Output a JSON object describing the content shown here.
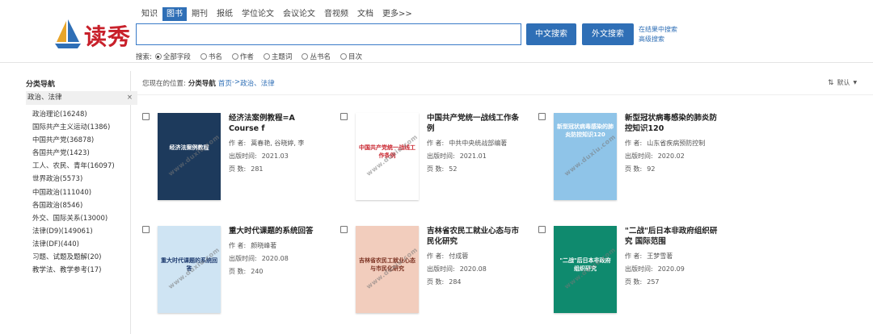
{
  "logo": {
    "text": "读秀"
  },
  "tabs": [
    {
      "label": "知识",
      "active": false
    },
    {
      "label": "图书",
      "active": true
    },
    {
      "label": "期刊",
      "active": false
    },
    {
      "label": "报纸",
      "active": false
    },
    {
      "label": "学位论文",
      "active": false
    },
    {
      "label": "会议论文",
      "active": false
    },
    {
      "label": "音视频",
      "active": false
    },
    {
      "label": "文档",
      "active": false
    },
    {
      "label": "更多>>",
      "active": false
    }
  ],
  "search": {
    "value": "",
    "cn_button": "中文搜索",
    "en_button": "外文搜索"
  },
  "side_links": {
    "in_results": "在结果中搜索",
    "advanced": "高级搜索"
  },
  "scope": {
    "label": "搜索:",
    "options": [
      {
        "label": "全部字段",
        "checked": true
      },
      {
        "label": "书名",
        "checked": false
      },
      {
        "label": "作者",
        "checked": false
      },
      {
        "label": "主题词",
        "checked": false
      },
      {
        "label": "丛书名",
        "checked": false
      },
      {
        "label": "目次",
        "checked": false
      }
    ]
  },
  "sidebar": {
    "title": "分类导航",
    "selected": "政治、法律",
    "close": "×",
    "items": [
      "政治理论(16248)",
      "国际共产主义运动(1386)",
      "中国共产党(36878)",
      "各国共产党(1423)",
      "工人、农民、青年(16097)",
      "世界政治(5573)",
      "中国政治(111040)",
      "各国政治(8546)",
      "外交、国际关系(13000)",
      "法律(D9)(149061)",
      "法律(DF)(440)",
      "习题、试题及题解(20)",
      "教学法、教学参考(17)"
    ]
  },
  "breadcrumb": {
    "prefix": "您现在的位置:",
    "section": "分类导航",
    "home": "首页",
    "sep": "->",
    "current": "政治、法律"
  },
  "sort": {
    "arrow": "⇅",
    "label": "默认",
    "caret": "▼"
  },
  "books": [
    {
      "title": "经济法案例教程=A Course f",
      "author_key": "作 者:",
      "author": "蒿春艳, 谷晓婷, 李",
      "date_key": "出版时间:",
      "date": "2021.03",
      "pages_key": "页 数:",
      "pages": "281",
      "cover_text": "经济法案例教程",
      "cover_bg": "#1d3a5c",
      "cover_fg": "#ffffff"
    },
    {
      "title": "中国共产党统一战线工作条例",
      "author_key": "作 者:",
      "author": "中共中央统战部编著",
      "date_key": "出版时间:",
      "date": "2021.01",
      "pages_key": "页 数:",
      "pages": "52",
      "cover_text": "中国共产党统一战线工作条例",
      "cover_bg": "#ffffff",
      "cover_fg": "#c8202a"
    },
    {
      "title": "新型冠状病毒感染的肺炎防控知识120",
      "author_key": "作 者:",
      "author": "山东省疾病预防控制",
      "date_key": "出版时间:",
      "date": "2020.02",
      "pages_key": "页 数:",
      "pages": "92",
      "cover_text": "新型冠状病毒感染的肺炎防控知识120",
      "cover_bg": "#8fc4e8",
      "cover_fg": "#ffffff"
    },
    {
      "title": "重大时代课题的系统回答",
      "author_key": "作 者:",
      "author": "颜晓峰著",
      "date_key": "出版时间:",
      "date": "2020.08",
      "pages_key": "页 数:",
      "pages": "240",
      "cover_text": "重大时代课题的系统回答",
      "cover_bg": "#cfe4f3",
      "cover_fg": "#1d3a6e"
    },
    {
      "title": "吉林省农民工就业心态与市民化研究",
      "author_key": "作 者:",
      "author": "付成蓉",
      "date_key": "出版时间:",
      "date": "2020.08",
      "pages_key": "页 数:",
      "pages": "284",
      "cover_text": "吉林省农民工就业心态与市民化研究",
      "cover_bg": "#f2cdbd",
      "cover_fg": "#7a3020"
    },
    {
      "title": "\"二战\"后日本非政府组织研究 国际范围",
      "author_key": "作 者:",
      "author": "王梦雪著",
      "date_key": "出版时间:",
      "date": "2020.09",
      "pages_key": "页 数:",
      "pages": "257",
      "cover_text": "\"二战\"后日本非政府组织研究",
      "cover_bg": "#0f8a6e",
      "cover_fg": "#ffffff"
    }
  ],
  "watermark": "www.duxiu.com"
}
